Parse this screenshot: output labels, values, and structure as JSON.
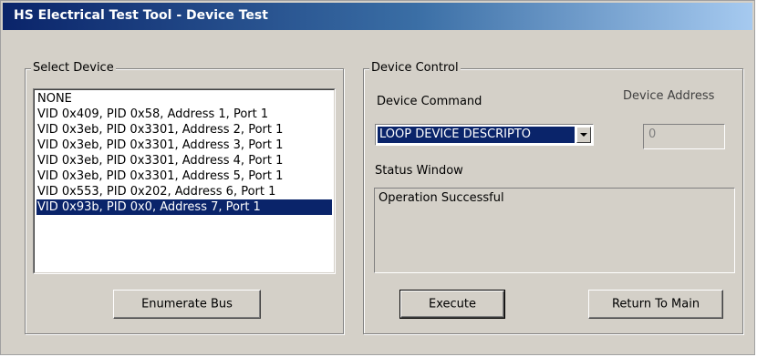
{
  "window": {
    "title": "HS Electrical Test Tool - Device Test"
  },
  "select_device": {
    "legend": "Select Device",
    "items": [
      "NONE",
      "VID 0x409, PID 0x58, Address 1, Port 1",
      "VID 0x3eb, PID 0x3301, Address 2, Port 1",
      "VID 0x3eb, PID 0x3301, Address 3, Port 1",
      "VID 0x3eb, PID 0x3301, Address 4, Port 1",
      "VID 0x3eb, PID 0x3301, Address 5, Port 1",
      "VID 0x553, PID 0x202, Address 6, Port 1",
      "VID 0x93b, PID 0x0, Address 7, Port 1"
    ],
    "selected_index": 7,
    "enumerate_label": "Enumerate Bus"
  },
  "device_control": {
    "legend": "Device Control",
    "command_label": "Device Command",
    "command_value": "LOOP DEVICE DESCRIPTO",
    "address_label": "Device Address",
    "address_value": "0",
    "status_label": "Status Window",
    "status_text": "Operation Successful",
    "execute_label": "Execute",
    "return_label": "Return To Main"
  },
  "colors": {
    "selection": "#0a246a",
    "face": "#d4d0c8"
  },
  "icons": {
    "combo_arrow": "chevron-down-icon"
  }
}
